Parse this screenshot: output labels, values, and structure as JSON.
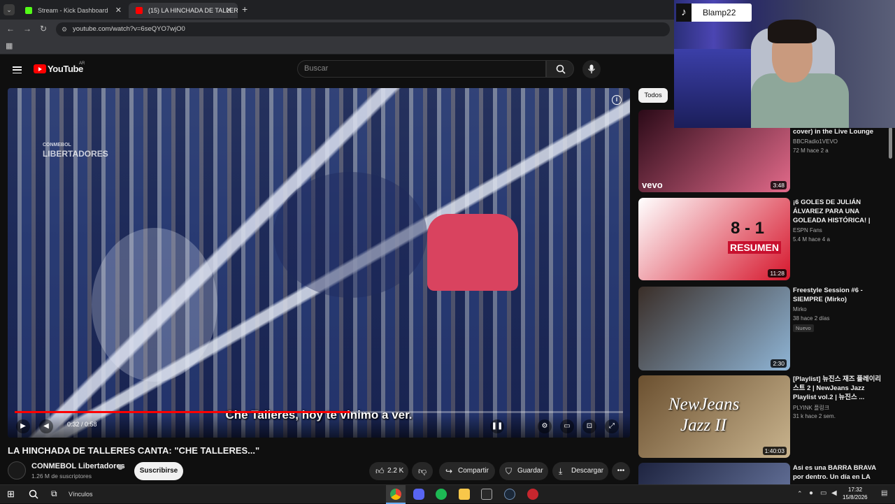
{
  "browser": {
    "tabs": [
      {
        "label": "Stream - Kick Dashboard",
        "active": false
      },
      {
        "label": "(15) LA HINCHADA DE TALLERE",
        "active": true
      }
    ],
    "url": "youtube.com/watch?v=6seQYO7wjO0"
  },
  "youtube": {
    "logo_text": "YouTube",
    "country": "AR",
    "search_placeholder": "Buscar"
  },
  "player": {
    "subtitle": "Che Talleres, hoy te vinimo  a ver.",
    "time": "0:32 / 0:58",
    "progress": 0.552,
    "watermark_line1": "CONMEBOL",
    "watermark_line2": "LIBERTADORES"
  },
  "video": {
    "title": "LA HINCHADA DE TALLERES CANTA: \"CHE TALLERES...\"",
    "channel": "CONMEBOL Libertadores",
    "subscribers": "1.26 M de suscriptores",
    "subscribe_label": "Suscribirse",
    "likes": "2.2 K",
    "share_label": "Compartir",
    "save_label": "Guardar",
    "download_label": "Descargar"
  },
  "sidebar": {
    "filter": "Todos",
    "items": [
      {
        "title": "cover) in the Live Lounge",
        "channel": "BBCRadio1VEVO",
        "meta": "72 M   hace 2 a",
        "duration": "3:48",
        "thumb_text": "vevo",
        "colors": [
          "#2b0a18",
          "#e26a8a"
        ]
      },
      {
        "title": "¡6 GOLES DE JULIÁN ÁLVAREZ PARA UNA GOLEADA HISTÓRICA! | Riv...",
        "channel": "ESPN Fans",
        "meta": "5.4 M   hace 4 a",
        "duration": "11:28",
        "thumb_text": "8 - 1",
        "thumb_text2": "RESUMEN",
        "colors": [
          "#ffffff",
          "#d6162c"
        ]
      },
      {
        "title": "Freestyle Session #6 - SIEMPRE (Mirko)",
        "channel": "Mirko",
        "meta": "38   hace 2 días",
        "badge": "Nuevo",
        "duration": "2:30",
        "colors": [
          "#3a2e28",
          "#8fb5d6"
        ]
      },
      {
        "title": "[Playlist] 뉴진스 재즈 플레이리스트 2 | NewJeans Jazz Playlist vol.2 | 뉴진스 ...",
        "channel": "PLYINK 플링크",
        "meta": "31 k   hace 2 sem.",
        "duration": "1:40:03",
        "thumb_text": "NewJeans",
        "thumb_text2": "Jazz II",
        "colors": [
          "#6b5030",
          "#c9b48e"
        ]
      },
      {
        "title": "Asi es una BARRA BRAVA por dentro. Un día en LA FIEL de",
        "colors": [
          "#1e2440",
          "#5e6b92"
        ]
      }
    ]
  },
  "overlay": {
    "tiktok_name": "Blamp22"
  },
  "taskbar": {
    "search_label": "Vínculos",
    "time": "17:32",
    "date": "15/8/2026"
  }
}
